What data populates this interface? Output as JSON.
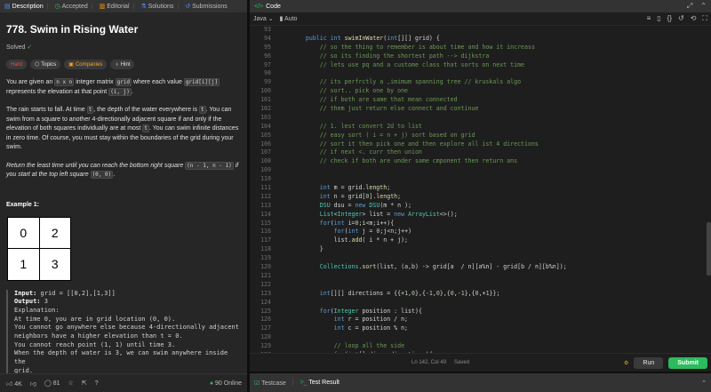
{
  "left_tabs": [
    {
      "icon": "document-icon",
      "glyph": "▤",
      "label": "Description"
    },
    {
      "icon": "clock-icon",
      "glyph": "◷",
      "label": "Accepted"
    },
    {
      "icon": "book-icon",
      "glyph": "▥",
      "label": "Editorial"
    },
    {
      "icon": "flask-icon",
      "glyph": "⚗",
      "label": "Solutions"
    },
    {
      "icon": "history-icon",
      "glyph": "↺",
      "label": "Submissions"
    }
  ],
  "problem": {
    "title": "778. Swim in Rising Water",
    "solved_label": "Solved",
    "tags": [
      "Hard",
      "Topics",
      "Companies",
      "Hint"
    ],
    "desc1_a": "You are given an ",
    "desc1_code1": "n x n",
    "desc1_b": " integer matrix ",
    "desc1_code2": "grid",
    "desc1_c": " where each value ",
    "desc1_code3": "grid[i][j]",
    "desc1_d": " represents the elevation at that point ",
    "desc1_code4": "(i, j)",
    "desc1_e": ".",
    "desc2_a": "The rain starts to fall. At time ",
    "desc2_code1": "t",
    "desc2_b": ", the depth of the water everywhere is ",
    "desc2_code2": "t",
    "desc2_c": ". You can swim from a square to another 4-directionally adjacent square if and only if the elevation of both squares individually are at most ",
    "desc2_code3": "t",
    "desc2_d": ". You can swim infinite distances in zero time. Of course, you must stay within the boundaries of the grid during your swim.",
    "desc3_a": "Return the least time until you can reach the bottom right square ",
    "desc3_code1": "(n - 1, n - 1)",
    "desc3_b": " if you start at the top left square ",
    "desc3_code2": "(0, 0)",
    "desc3_c": ".",
    "example_title": "Example 1:",
    "grid_values": [
      "0",
      "2",
      "1",
      "3"
    ],
    "input_label": "Input:",
    "input_value": " grid = [[0,2],[1,3]]",
    "output_label": "Output:",
    "output_value": " 3",
    "explanation": "Explanation:\nAt time 0, you are in grid location (0, 0).\nYou cannot go anywhere else because 4-directionally adjacent\nneighbors have a higher elevation than t = 0.\nYou cannot reach point (1, 1) until time 3.\nWhen the depth of water is 3, we can swim anywhere inside the\ngrid."
  },
  "left_footer": {
    "likes": "4K",
    "comments": "81",
    "online": "90 Online"
  },
  "code_panel": {
    "title": "Code",
    "language": "Java",
    "autosave": "Auto"
  },
  "code_lines": [
    {
      "n": "93",
      "t": ""
    },
    {
      "n": "94",
      "t": "    public int swimInWater(int[][] grid) {"
    },
    {
      "n": "95",
      "t": "        // so the thing to remember is about time and how it increass"
    },
    {
      "n": "96",
      "t": "        // so its finding the shortest path --> dijkstra"
    },
    {
      "n": "97",
      "t": "        // lets use pq and a custome class that sorts on next time"
    },
    {
      "n": "98",
      "t": ""
    },
    {
      "n": "99",
      "t": "        // its perfrctly a ,imimum spanning tree // kruskals algo"
    },
    {
      "n": "100",
      "t": "        // sort.. pick one by one"
    },
    {
      "n": "101",
      "t": "        // if both are same that mean connected"
    },
    {
      "n": "102",
      "t": "        // them just return else connect and continue"
    },
    {
      "n": "103",
      "t": ""
    },
    {
      "n": "104",
      "t": "        // 1. lest convert 2d to list"
    },
    {
      "n": "105",
      "t": "        // easy sort ( i = n + j) sort based on grid"
    },
    {
      "n": "106",
      "t": "        // sort it then pick one and then explore all ist 4 directions"
    },
    {
      "n": "107",
      "t": "        // if next <. curr then union"
    },
    {
      "n": "108",
      "t": "        // check if both are under same cmponent then return ans"
    },
    {
      "n": "109",
      "t": ""
    },
    {
      "n": "110",
      "t": ""
    },
    {
      "n": "111",
      "t": "        int m = grid.length;"
    },
    {
      "n": "112",
      "t": "        int n = grid[0].length;"
    },
    {
      "n": "113",
      "t": "        DSU dsu = new DSU(m * n );"
    },
    {
      "n": "114",
      "t": "        List<Integer> list = new ArrayList<>();"
    },
    {
      "n": "115",
      "t": "        for(int i=0;i<m;i++){"
    },
    {
      "n": "116",
      "t": "            for(int j = 0;j<n;j++)"
    },
    {
      "n": "117",
      "t": "            list.add( i * n + j);"
    },
    {
      "n": "118",
      "t": "        }"
    },
    {
      "n": "119",
      "t": ""
    },
    {
      "n": "120",
      "t": "        Collections.sort(list, (a,b) -> grid[a  / n][a%n] - grid[b / n][b%n]);"
    },
    {
      "n": "121",
      "t": ""
    },
    {
      "n": "122",
      "t": ""
    },
    {
      "n": "123",
      "t": "        int[][] directions = {{+1,0},{-1,0},{0,-1},{0,+1}};"
    },
    {
      "n": "124",
      "t": ""
    },
    {
      "n": "125",
      "t": "        for(Integer position : list){"
    },
    {
      "n": "126",
      "t": "            int r = position / n;"
    },
    {
      "n": "127",
      "t": "            int c = position % n;"
    },
    {
      "n": "128",
      "t": ""
    },
    {
      "n": "129",
      "t": "            // loop all the side"
    },
    {
      "n": "130",
      "t": "            for(int[] dir : directions){"
    }
  ],
  "status": {
    "cursor": "Ln 142, Col 49",
    "saved": "Saved",
    "run": "Run",
    "submit": "Submit"
  },
  "bottom_tabs": {
    "testcase": "Testcase",
    "result": "Test Result"
  }
}
